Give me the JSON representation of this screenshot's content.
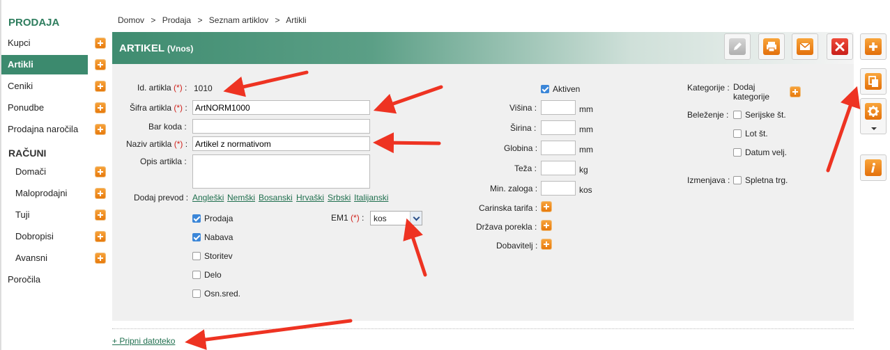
{
  "sidebar": {
    "section_sales": "PRODAJA",
    "items_sales": [
      {
        "label": "Kupci",
        "has_add": true
      },
      {
        "label": "Artikli",
        "has_add": true,
        "active": true
      },
      {
        "label": "Ceniki",
        "has_add": true
      },
      {
        "label": "Ponudbe",
        "has_add": true
      },
      {
        "label": "Prodajna naročila",
        "has_add": true
      }
    ],
    "section_invoices": "RAČUNI",
    "items_invoices": [
      {
        "label": "Domači",
        "has_add": true
      },
      {
        "label": "Maloprodajni",
        "has_add": true
      },
      {
        "label": "Tuji",
        "has_add": true
      },
      {
        "label": "Dobropisi",
        "has_add": true
      },
      {
        "label": "Avansni",
        "has_add": true
      }
    ],
    "reports": "Poročila"
  },
  "breadcrumb": {
    "items": [
      "Domov",
      "Prodaja",
      "Seznam artiklov",
      "Artikli"
    ],
    "sep": ">"
  },
  "header": {
    "title": "ARTIKEL",
    "subtitle": "(Vnos)"
  },
  "toolbar": {
    "buttons": [
      "edit-icon",
      "print-icon",
      "email-icon",
      "delete-icon",
      "add-icon"
    ],
    "side_buttons": [
      "copy-icon",
      "settings-icon",
      "info-icon"
    ]
  },
  "form": {
    "req_marker": "(*)",
    "colon": ":",
    "id_label": "Id. artikla",
    "id_value": "1010",
    "code_label": "Šifra artikla",
    "code_value": "ArtNORM1000",
    "barcode_label": "Bar koda",
    "barcode_value": "",
    "name_label": "Naziv artikla",
    "name_value": "Artikel z normativom",
    "desc_label": "Opis artikla",
    "desc_value": "",
    "translation_label": "Dodaj prevod :",
    "languages": [
      "Angleški",
      "Nemški",
      "Bosanski",
      "Hrvaški",
      "Srbski",
      "Italijanski"
    ],
    "checkboxes": [
      {
        "label": "Prodaja",
        "checked": true
      },
      {
        "label": "Nabava",
        "checked": true
      },
      {
        "label": "Storitev",
        "checked": false
      },
      {
        "label": "Delo",
        "checked": false
      },
      {
        "label": "Osn.sred.",
        "checked": false
      }
    ],
    "em1_label": "EM1",
    "em1_value": "kos",
    "active_label": "Aktiven",
    "active_checked": true,
    "height_label": "Višina :",
    "width_label": "Širina :",
    "depth_label": "Globina :",
    "weight_label": "Teža :",
    "min_stock_label": "Min. zaloga :",
    "customs_label": "Carinska tarifa :",
    "origin_label": "Država porekla :",
    "supplier_label": "Dobavitelj :",
    "unit_mm": "mm",
    "unit_kg": "kg",
    "unit_kos": "kos",
    "categories_label": "Kategorije :",
    "categories_add": "Dodaj kategorije",
    "tracking_label": "Beleženje :",
    "tracking_options": [
      {
        "label": "Serijske št.",
        "checked": false
      },
      {
        "label": "Lot št.",
        "checked": false
      },
      {
        "label": "Datum velj.",
        "checked": false
      }
    ],
    "exchange_label": "Izmenjava :",
    "exchange_option": {
      "label": "Spletna trg.",
      "checked": false
    }
  },
  "attach": {
    "label": "+ Pripni datoteko"
  },
  "colors": {
    "accent_green": "#3c8a6e",
    "link_green": "#1f6f4e",
    "orange": "#f08a1c",
    "arrow_red": "#ee3322",
    "required_red": "#d0201a"
  }
}
